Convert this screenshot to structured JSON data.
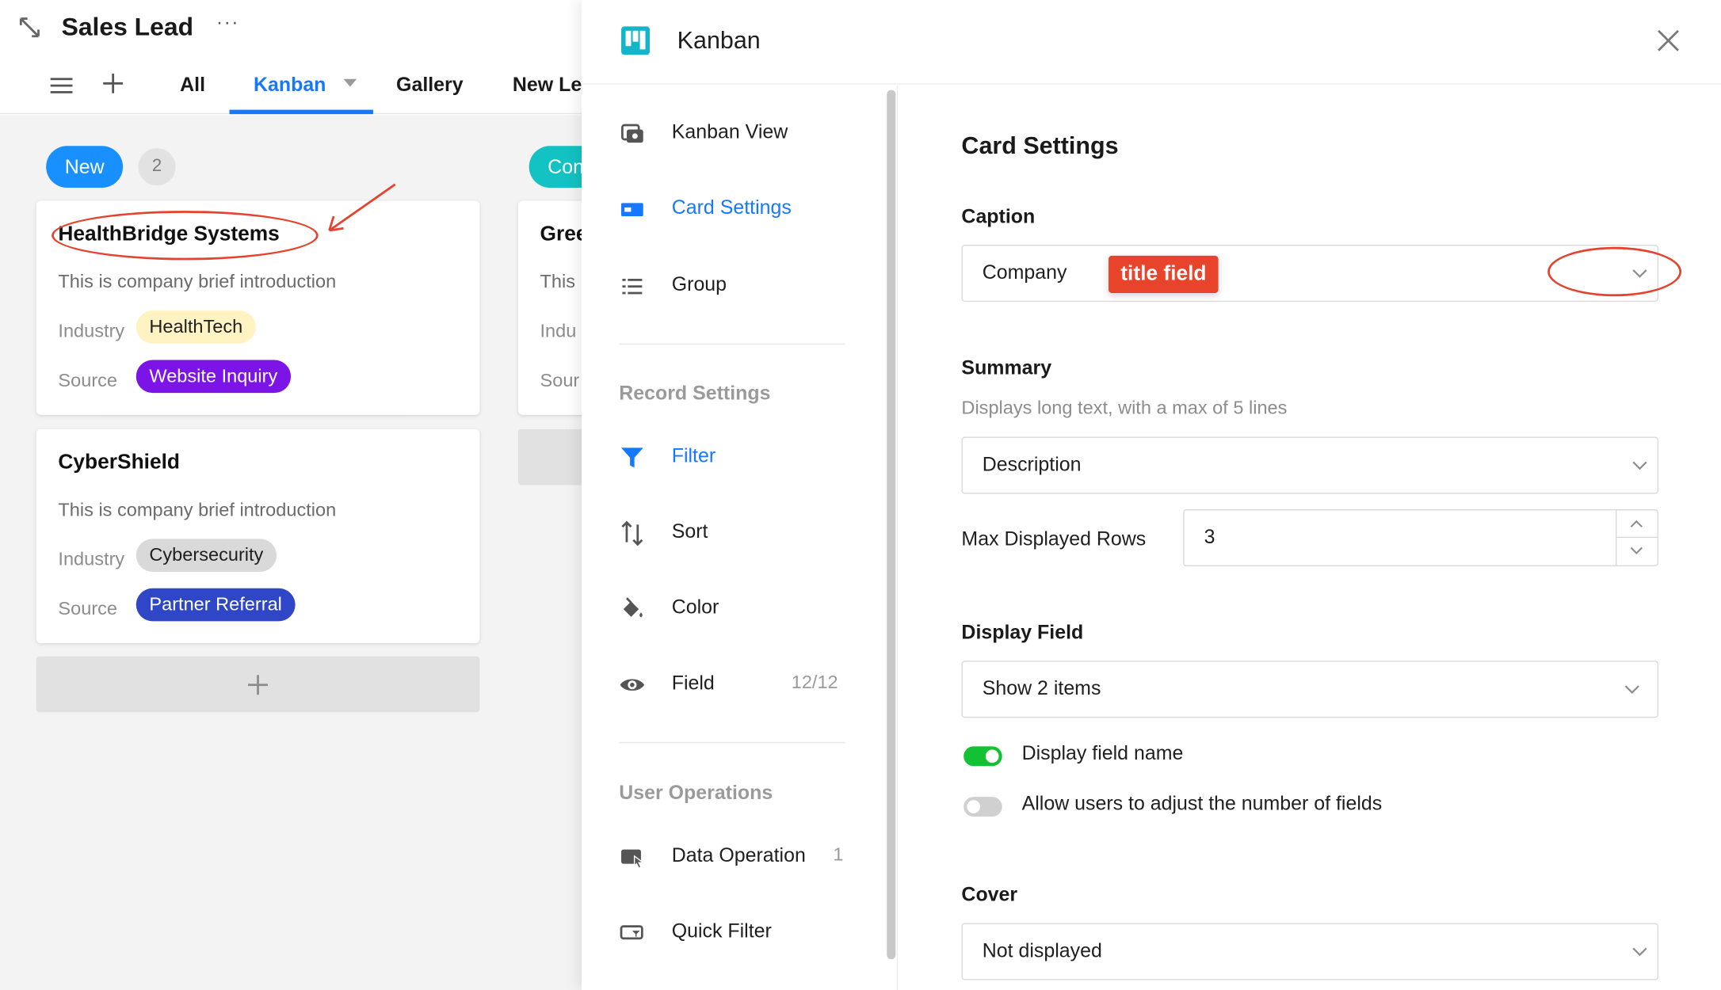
{
  "header": {
    "title": "Sales Lead",
    "more": "···",
    "tabs": [
      {
        "label": "All"
      },
      {
        "label": "Kanban"
      },
      {
        "label": "Gallery"
      },
      {
        "label": "New Le"
      }
    ]
  },
  "board": {
    "columns": [
      {
        "tag": "New",
        "count": "2",
        "color": "#1890ff"
      },
      {
        "tag": "Con",
        "color": "#13c2c2"
      }
    ],
    "cards": [
      {
        "title": "HealthBridge Systems",
        "description": "This is company brief introduction",
        "industry_label": "Industry",
        "industry": "HealthTech",
        "source_label": "Source",
        "source": "Website Inquiry"
      },
      {
        "title": "CyberShield",
        "description": "This is company brief introduction",
        "industry_label": "Industry",
        "industry": "Cybersecurity",
        "source_label": "Source",
        "source": "Partner Referral"
      }
    ],
    "partial_card": {
      "title": "Gree",
      "description": "This",
      "industry_label": "Indu",
      "source_label": "Sour"
    },
    "colors": {
      "healthtech_bg": "#fff3c4",
      "website_bg": "#7c14e8",
      "cyber_bg": "#d9d9d9",
      "partner_bg": "#2f46c6",
      "annotation": "#e4432d"
    }
  },
  "drawer": {
    "title": "Kanban",
    "nav": {
      "items": [
        {
          "label": "Kanban View",
          "icon": "kanban-view-icon"
        },
        {
          "label": "Card Settings",
          "icon": "card-settings-icon"
        },
        {
          "label": "Group",
          "icon": "group-list-icon"
        }
      ],
      "record_section": "Record Settings",
      "record_items": [
        {
          "label": "Filter",
          "icon": "filter-icon"
        },
        {
          "label": "Sort",
          "icon": "sort-icon"
        },
        {
          "label": "Color",
          "icon": "paint-bucket-icon"
        },
        {
          "label": "Field",
          "icon": "eye-icon",
          "count": "12/12"
        }
      ],
      "user_section": "User Operations",
      "user_items": [
        {
          "label": "Data Operation",
          "icon": "data-operation-icon",
          "count": "1"
        },
        {
          "label": "Quick Filter",
          "icon": "quick-filter-icon"
        }
      ]
    },
    "card_settings": {
      "heading": "Card Settings",
      "caption_label": "Caption",
      "caption_value": "Company",
      "caption_badge": "title field",
      "summary_label": "Summary",
      "summary_hint": "Displays long text, with a max of 5 lines",
      "summary_value": "Description",
      "max_rows_label": "Max Displayed Rows",
      "max_rows_value": "3",
      "display_field_label": "Display Field",
      "display_field_value": "Show 2 items",
      "toggle_field_name": {
        "label": "Display field name",
        "on": true
      },
      "toggle_adjust": {
        "label": "Allow users to adjust the number of fields",
        "on": false
      },
      "cover_label": "Cover",
      "cover_value": "Not displayed"
    },
    "accent": "#1677ff",
    "toggle_on_color": "#13c234",
    "toggle_off_color": "#d0d0d0"
  }
}
